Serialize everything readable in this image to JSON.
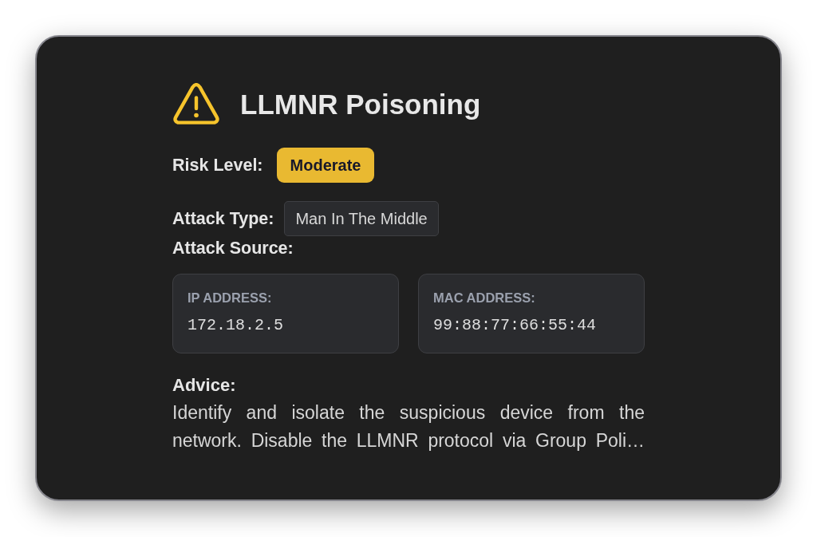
{
  "alert": {
    "title": "LLMNR Poisoning",
    "risk": {
      "label": "Risk Level:",
      "value": "Moderate"
    },
    "attack_type": {
      "label": "Attack Type:",
      "value": "Man In The Middle"
    },
    "attack_source": {
      "label": "Attack Source:",
      "fields": [
        {
          "label": "IP ADDRESS:",
          "value": "172.18.2.5"
        },
        {
          "label": "MAC ADDRESS:",
          "value": "99:88:77:66:55:44"
        }
      ]
    },
    "advice": {
      "label": "Advice:",
      "text": "Identify and isolate the suspicious device from the network. Disable the LLMNR protocol via Group Poli…"
    }
  }
}
